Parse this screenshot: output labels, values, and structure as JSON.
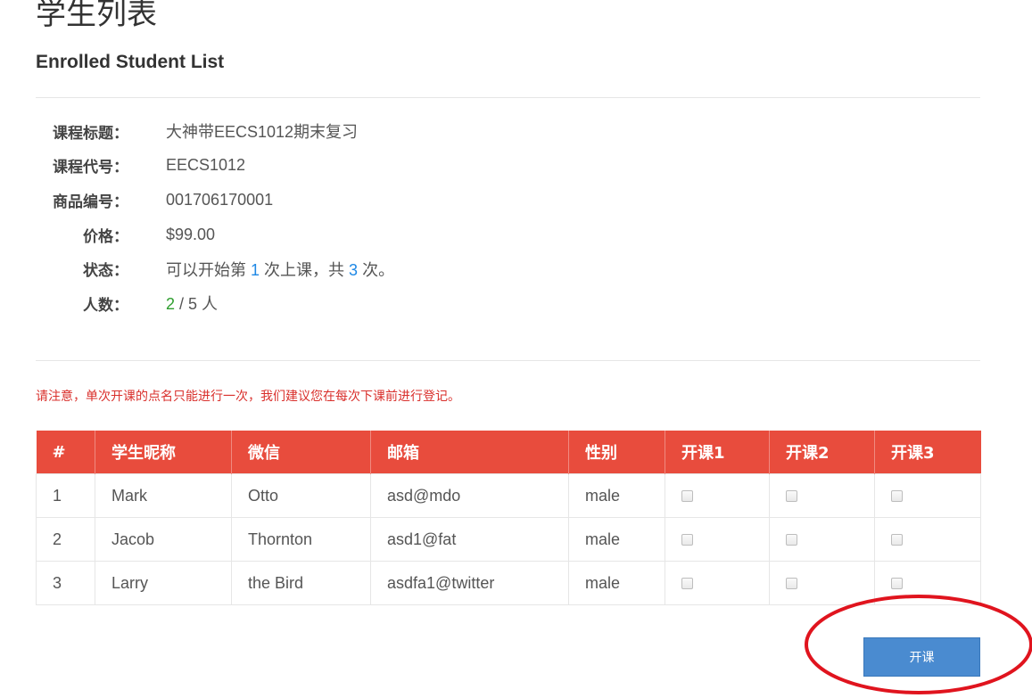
{
  "header": {
    "title": "学生列表",
    "subtitle": "Enrolled Student List"
  },
  "course_info": [
    {
      "label": "课程标题：",
      "value": "大神带EECS1012期末复习"
    },
    {
      "label": "课程代号：",
      "value": "EECS1012"
    },
    {
      "label": "商品编号：",
      "value": "001706170001"
    },
    {
      "label": "价格：",
      "value": "$99.00"
    }
  ],
  "status": {
    "label": "状态：",
    "prefix": "可以开始第 ",
    "current": "1",
    "middle": " 次上课，共 ",
    "total": "3",
    "suffix": " 次。"
  },
  "enrollment": {
    "label": "人数：",
    "enrolled": "2",
    "rest": " / 5 人"
  },
  "notice": "请注意，单次开课的点名只能进行一次，我们建议您在每次下课前进行登记。",
  "table": {
    "headers": [
      "#",
      "学生昵称",
      "微信",
      "邮箱",
      "性别",
      "开课1",
      "开课2",
      "开课3"
    ],
    "rows": [
      [
        "1",
        "Mark",
        "Otto",
        "asd@mdo",
        "male"
      ],
      [
        "2",
        "Jacob",
        "Thornton",
        "asd1@fat",
        "male"
      ],
      [
        "3",
        "Larry",
        "the Bird",
        "asdfa1@twitter",
        "male"
      ]
    ]
  },
  "actions": {
    "start_label": "开课"
  },
  "colors": {
    "header_bg": "#e84c3d",
    "button_bg": "#4a8bd0",
    "notice": "#d9302c",
    "annotation": "#e0141e"
  }
}
